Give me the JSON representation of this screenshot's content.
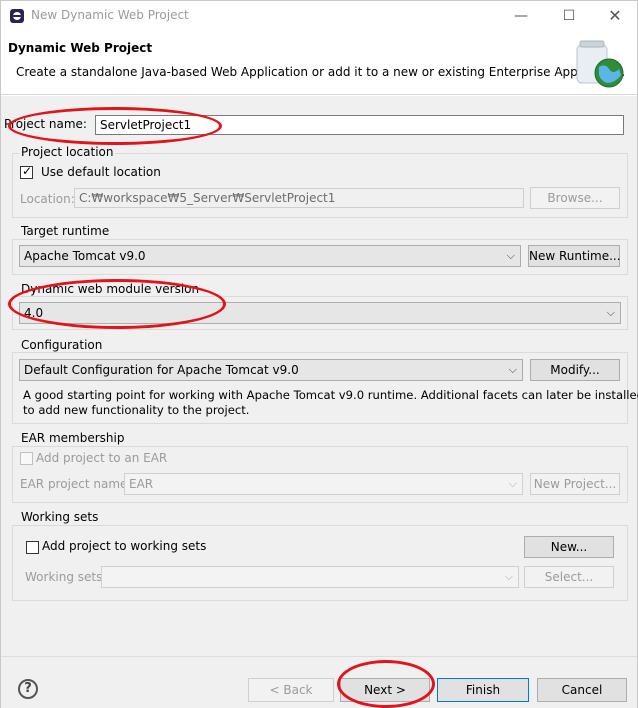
{
  "window": {
    "title": "New Dynamic Web Project",
    "minimize": "—",
    "maximize": "☐",
    "close": "✕",
    "app_icon": "eclipse-icon"
  },
  "header": {
    "title": "Dynamic Web Project",
    "description": "Create a standalone Java-based Web Application or add it to a new or existing Enterprise Application.",
    "icon": "web-project-jar-globe-icon"
  },
  "project": {
    "name_label": "Project name:",
    "name_value": "ServletProject1"
  },
  "location": {
    "group_label": "Project location",
    "use_default_label": "Use default location",
    "use_default_checked": true,
    "location_label": "Location:",
    "location_value": "C:₩workspace₩5_Server₩ServletProject1",
    "browse_label": "Browse..."
  },
  "target_runtime": {
    "group_label": "Target runtime",
    "value": "Apache Tomcat v9.0",
    "new_runtime_label": "New Runtime..."
  },
  "module_version": {
    "group_label": "Dynamic web module version",
    "value": "4.0"
  },
  "configuration": {
    "group_label": "Configuration",
    "value": "Default Configuration for Apache Tomcat v9.0",
    "modify_label": "Modify...",
    "description_line1": "A good starting point for working with Apache Tomcat v9.0 runtime. Additional facets can later be installed",
    "description_line2": "to add new functionality to the project."
  },
  "ear": {
    "group_label": "EAR membership",
    "add_label": "Add project to an EAR",
    "add_checked": false,
    "project_name_label": "EAR project name:",
    "project_name_value": "EAR",
    "new_project_label": "New Project..."
  },
  "working_sets": {
    "group_label": "Working sets",
    "add_label": "Add project to working sets",
    "add_checked": false,
    "new_label": "New...",
    "sets_label": "Working sets:",
    "sets_value": "",
    "select_label": "Select..."
  },
  "footer": {
    "help": "?",
    "back_label": "< Back",
    "next_label": "Next >",
    "finish_label": "Finish",
    "cancel_label": "Cancel"
  },
  "annotation_color": "#e0141a"
}
